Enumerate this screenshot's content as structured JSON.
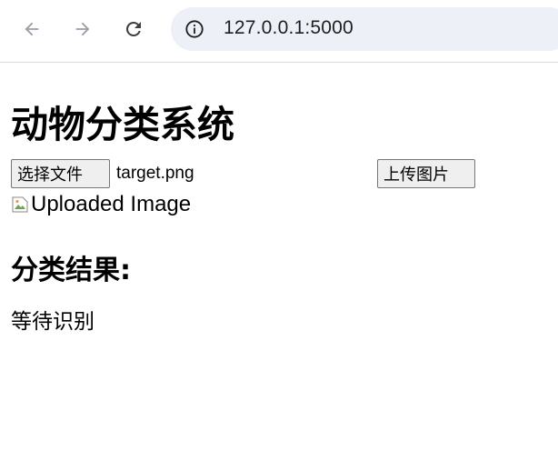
{
  "browser": {
    "url": "127.0.0.1:5000",
    "icons": {
      "back": "back-arrow-icon",
      "forward": "forward-arrow-icon",
      "reload": "reload-icon",
      "info": "info-icon"
    }
  },
  "page": {
    "title": "动物分类系统",
    "choose_file_label": "选择文件",
    "file_name": "target.png",
    "upload_label": "上传图片",
    "image_alt": "Uploaded Image",
    "result_heading": "分类结果:",
    "result_text": "等待识别"
  },
  "colors": {
    "omnibox_bg": "#edf0f7",
    "button_bg": "#efefef",
    "button_border": "#767676",
    "icon_gray": "#5f6368"
  }
}
